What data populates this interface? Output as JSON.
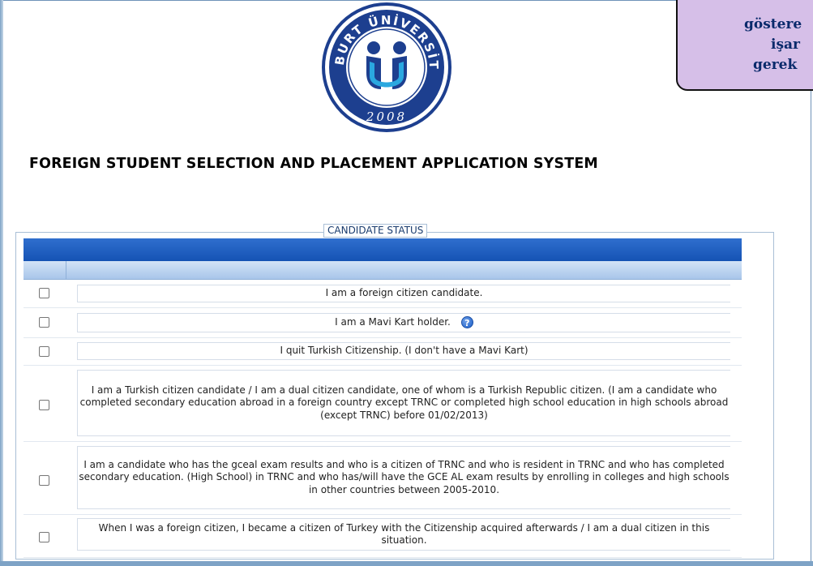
{
  "logo": {
    "name": "BAYBURT ÜNİVERSİTESİ",
    "year": "2008"
  },
  "callout": {
    "line1": "göstere",
    "line2": "işar",
    "line3": "gerek"
  },
  "app": {
    "title": "FOREIGN STUDENT SELECTION AND PLACEMENT APPLICATION SYSTEM"
  },
  "candidate_status": {
    "legend": "CANDIDATE STATUS",
    "header_color": "#1553b4",
    "options": [
      {
        "label": "I am a foreign citizen candidate.",
        "checked": false
      },
      {
        "label": "I am a Mavi Kart holder.",
        "checked": false,
        "icon": "help-icon"
      },
      {
        "label": "I quit Turkish Citizenship. (I don't have a Mavi Kart)",
        "checked": false
      },
      {
        "label": "I am a Turkish citizen candidate / I am a dual citizen candidate, one of whom is a Turkish Republic citizen. (I am a candidate who completed secondary education abroad in a foreign country except TRNC or completed high school education in high schools abroad (except TRNC) before 01/02/2013)",
        "checked": false
      },
      {
        "label": "I am a candidate who has the gceal exam results and who is a citizen of TRNC and who is resident in TRNC and who has completed secondary education. (High School) in TRNC and who has/will have the GCE AL exam results by enrolling in colleges and high schools in other countries between 2005-2010.",
        "checked": false
      },
      {
        "label": "When I was a foreign citizen, I became a citizen of Turkey with the Citizenship acquired afterwards / I am a dual citizen in this situation.",
        "checked": false
      }
    ]
  }
}
